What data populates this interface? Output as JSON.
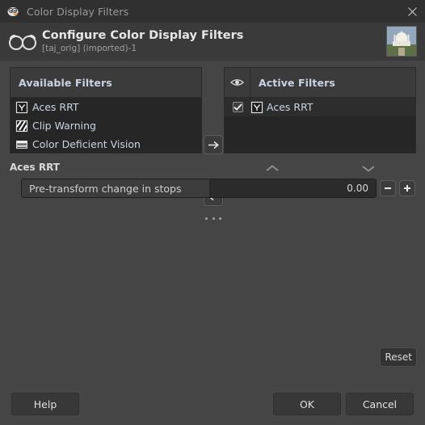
{
  "window": {
    "title": "Color Display Filters",
    "icon": "wilber-icon",
    "close_label": "✕"
  },
  "header": {
    "icon": "spectacles-icon",
    "title": "Configure Color Display Filters",
    "subtitle": "[taj_orig] (imported)-1",
    "thumbnail_name": "image-thumbnail"
  },
  "available_filters": {
    "header": "Available Filters",
    "items": [
      {
        "label": "Aces RRT",
        "icon": "gamma-icon"
      },
      {
        "label": "Clip Warning",
        "icon": "diagonal-stripes-icon"
      },
      {
        "label": "Color Deficient Vision",
        "icon": "color-bands-icon"
      },
      {
        "label": "",
        "icon": "clipped-icon"
      }
    ]
  },
  "active_filters": {
    "header": "Active Filters",
    "eye_column_icon": "eye-icon",
    "items": [
      {
        "label": "Aces RRT",
        "icon": "gamma-icon",
        "enabled": true,
        "check_glyph": "✔"
      }
    ]
  },
  "transfer": {
    "to_active_icon": "arrow-right-icon",
    "to_available_icon": "arrow-left-icon",
    "overflow_icon": "ellipsis-icon",
    "move_up_icon": "chevron-up-icon",
    "move_down_icon": "chevron-down-icon"
  },
  "settings": {
    "title": "Aces RRT",
    "slider": {
      "label": "Pre-transform change in stops",
      "value": "0.00",
      "decrement_icon": "minus-icon",
      "increment_icon": "plus-icon"
    }
  },
  "buttons": {
    "reset": "Reset",
    "help": "Help",
    "ok": "OK",
    "cancel": "Cancel"
  },
  "colors": {
    "window_bg": "#454545",
    "titlebar_bg": "#303030",
    "header_bg": "#3a3a3a",
    "list_bg": "#262626",
    "list_header_bg": "#3b3b3b",
    "list_text": "#c9d4e2",
    "title_text": "#9a9a9a"
  }
}
